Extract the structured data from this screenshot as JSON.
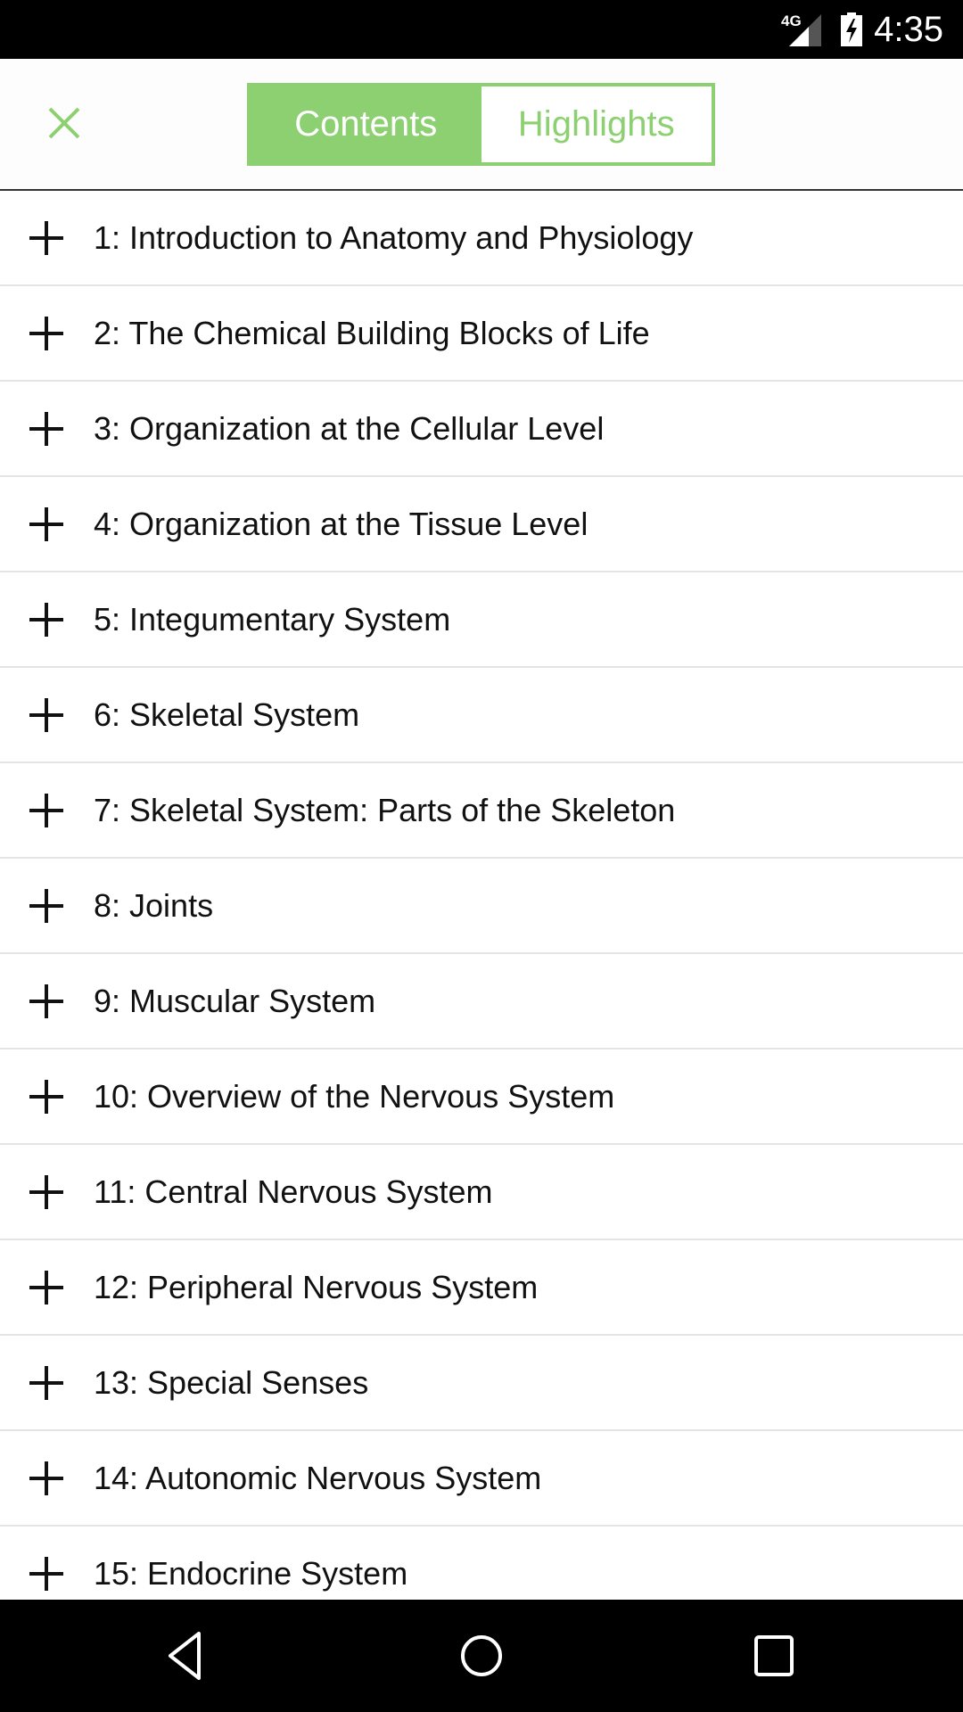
{
  "status_bar": {
    "network": "4G",
    "time": "4:35"
  },
  "header": {
    "close_icon": "close-icon",
    "tabs": [
      {
        "label": "Contents",
        "active": true
      },
      {
        "label": "Highlights",
        "active": false
      }
    ]
  },
  "accent_color": "#8cd071",
  "toc": {
    "items": [
      {
        "label": "1: Introduction to Anatomy and Physiology"
      },
      {
        "label": "2: The Chemical Building Blocks of Life"
      },
      {
        "label": "3: Organization at the Cellular Level"
      },
      {
        "label": "4: Organization at the Tissue Level"
      },
      {
        "label": "5: Integumentary System"
      },
      {
        "label": "6: Skeletal System"
      },
      {
        "label": "7: Skeletal System: Parts of the Skeleton"
      },
      {
        "label": "8: Joints"
      },
      {
        "label": "9: Muscular System"
      },
      {
        "label": "10: Overview of the Nervous System"
      },
      {
        "label": "11: Central Nervous System"
      },
      {
        "label": "12: Peripheral Nervous System"
      },
      {
        "label": "13: Special Senses"
      },
      {
        "label": "14: Autonomic Nervous System"
      },
      {
        "label": "15: Endocrine System"
      }
    ]
  }
}
